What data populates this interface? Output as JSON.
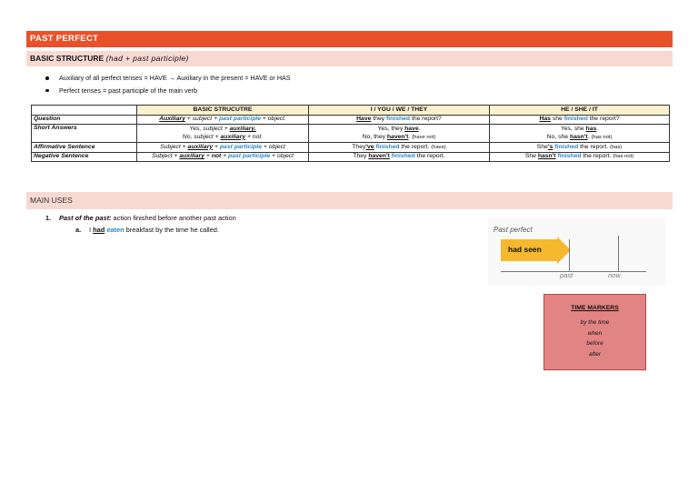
{
  "header": {
    "title": "PAST PERFECT"
  },
  "basic": {
    "label": "BASIC STRUCTURE",
    "formula": "(had + past participle)"
  },
  "bullets": [
    {
      "text": "Auxiliary of all perfect tenses = HAVE → Auxiliary in the present = HAVE or HAS"
    },
    {
      "text": "Perfect tenses = past participle of the main verb"
    }
  ],
  "table": {
    "headers": [
      "",
      "BASIC STRUCUTRE",
      "I / YOU / WE / THEY",
      "HE / SHE / IT"
    ],
    "rows": {
      "question": {
        "label": "Question",
        "structure": {
          "a": "Auxiliary",
          "b": " + subject + ",
          "c": "past participle",
          "d": " + object."
        },
        "plural": {
          "a": "Have",
          "b": " they ",
          "c": "finished",
          "d": " the report?"
        },
        "singular": {
          "a": "Has",
          "b": " she ",
          "c": "finished",
          "d": " the report?"
        }
      },
      "short": {
        "label": "Short Answers",
        "structure1": {
          "a": "Yes, subject + ",
          "b": "auxiliary."
        },
        "structure2": {
          "a": "No, subject + ",
          "b": "auxiliary",
          "c": " + not."
        },
        "plural1": {
          "a": "Yes, they ",
          "b": "have",
          "c": "."
        },
        "plural2": {
          "a": "No, they ",
          "b": "haven't",
          "c": ". ",
          "d": "(have not)"
        },
        "singular1": {
          "a": "Yes, she ",
          "b": "has",
          "c": "."
        },
        "singular2": {
          "a": "No, she ",
          "b": "hasn't",
          "c": ". ",
          "d": "(has not)"
        }
      },
      "affirmative": {
        "label": "Affirmative Sentence",
        "structure": {
          "a": "Subject + ",
          "b": "auxiliary",
          "c": " + ",
          "d": "past participle",
          "e": " + object"
        },
        "plural": {
          "a": "They",
          "b": "'ve",
          "c": " ",
          "d": "finished",
          "e": " the report.  ",
          "f": "(have)"
        },
        "singular": {
          "a": "She",
          "b": "'s",
          "c": " ",
          "d": "finished",
          "e": " the report. ",
          "f": "(has)"
        }
      },
      "negative": {
        "label": "Negative Sentence",
        "structure": {
          "a": "Subject + ",
          "b": "auxiliary",
          "c": " + ",
          "d": "not",
          "e": " + ",
          "f": "past participle",
          "g": "  + object"
        },
        "plural": {
          "a": "They ",
          "b": "haven't",
          "c": " ",
          "d": "finished",
          "e": " the report."
        },
        "singular": {
          "a": "She ",
          "b": "hasn't",
          "c": " ",
          "d": "finished",
          "e": " the report. ",
          "f": "(has not)"
        }
      }
    }
  },
  "main_uses": {
    "title": "MAIN USES",
    "items": [
      {
        "num": "1.",
        "title": "Past of the past:",
        "desc": " action finished before another past action",
        "example": {
          "letter": "a.",
          "a": "I ",
          "b": "had",
          "c": " ",
          "d": "eaten",
          "e": " breakfast by the time he called."
        }
      }
    ]
  },
  "timeline": {
    "title": "Past perfect",
    "arrow_label": "had seen",
    "past": "past",
    "now": "now",
    "arrow_color": "#f5b82e"
  },
  "time_markers": {
    "title": "TIME MARKERS",
    "items": [
      "by the time",
      "when",
      "before",
      "after"
    ]
  },
  "colors": {
    "header": "#e8512a",
    "subheader": "#f8d9d2",
    "accent_blue": "#2e86c8",
    "markers_box": "#e38484"
  }
}
